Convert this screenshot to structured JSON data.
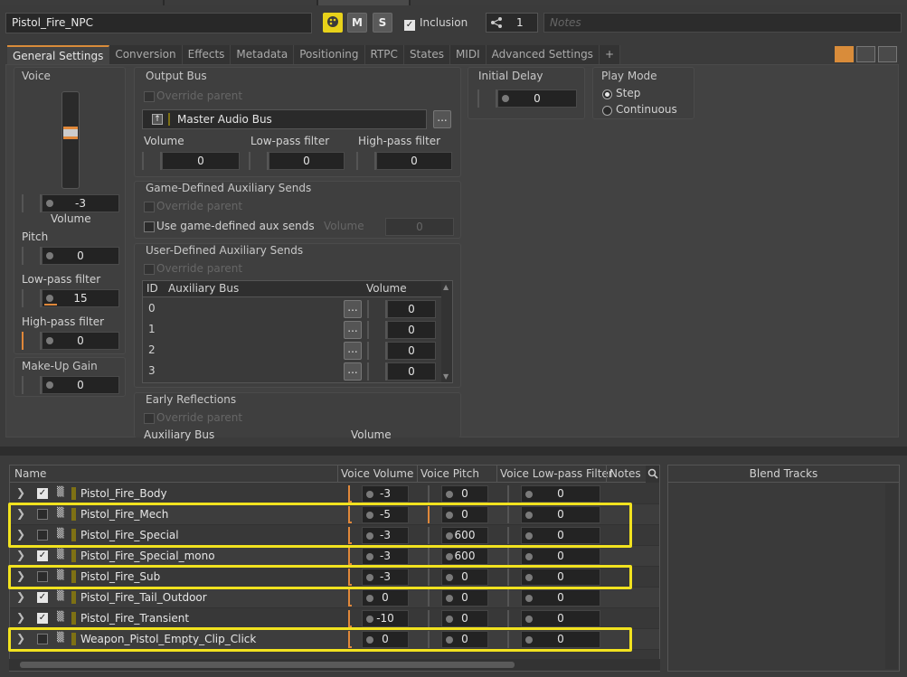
{
  "object_name": "Pistol_Fire_NPC",
  "toolbar": {
    "color_label": "",
    "mute_label": "M",
    "solo_label": "S",
    "inclusion_label": "Inclusion",
    "inclusion_checked": true,
    "share_count": "1",
    "notes_placeholder": "Notes"
  },
  "tabs": [
    "General Settings",
    "Conversion",
    "Effects",
    "Metadata",
    "Positioning",
    "RTPC",
    "States",
    "MIDI",
    "Advanced Settings",
    "+"
  ],
  "active_tab": "General Settings",
  "voice": {
    "title": "Voice",
    "volume_value": "-3",
    "volume_label": "Volume",
    "pitch_label": "Pitch",
    "pitch_value": "0",
    "lowpass_label": "Low-pass filter",
    "lowpass_value": "15",
    "highpass_label": "High-pass filter",
    "highpass_value": "0",
    "makeup_label": "Make-Up Gain",
    "makeup_value": "0"
  },
  "output_bus": {
    "title": "Output Bus",
    "override_label": "Override parent",
    "bus_name": "Master Audio Bus",
    "ellipsis": "...",
    "volume_label": "Volume",
    "volume_value": "0",
    "lowpass_label": "Low-pass filter",
    "lowpass_value": "0",
    "highpass_label": "High-pass filter",
    "highpass_value": "0"
  },
  "game_aux": {
    "title": "Game-Defined Auxiliary Sends",
    "override_label": "Override parent",
    "use_label": "Use game-defined aux sends",
    "volume_label": "Volume",
    "volume_value": "0"
  },
  "user_aux": {
    "title": "User-Defined Auxiliary Sends",
    "override_label": "Override parent",
    "col_id": "ID",
    "col_bus": "Auxiliary Bus",
    "col_volume": "Volume",
    "rows": [
      {
        "id": "0",
        "volume": "0"
      },
      {
        "id": "1",
        "volume": "0"
      },
      {
        "id": "2",
        "volume": "0"
      },
      {
        "id": "3",
        "volume": "0"
      }
    ]
  },
  "early_reflections": {
    "title": "Early Reflections",
    "override_label": "Override parent",
    "aux_bus_label": "Auxiliary Bus",
    "volume_label": "Volume"
  },
  "initial_delay": {
    "title": "Initial Delay",
    "value": "0"
  },
  "play_mode": {
    "title": "Play Mode",
    "step_label": "Step",
    "continuous_label": "Continuous",
    "selected": "Step"
  },
  "grid": {
    "columns": [
      "Name",
      "Voice Volume",
      "Voice Pitch",
      "Voice Low-pass Filter",
      "Notes"
    ],
    "rows": [
      {
        "name": "Pistol_Fire_Body",
        "checked": true,
        "volume": "-3",
        "pitch": "0",
        "lpf": "0",
        "highlight": false
      },
      {
        "name": "Pistol_Fire_Mech",
        "checked": false,
        "volume": "-5",
        "pitch": "0",
        "lpf": "0",
        "highlight": true
      },
      {
        "name": "Pistol_Fire_Special",
        "checked": false,
        "volume": "-3",
        "pitch": "600",
        "lpf": "0",
        "highlight": true
      },
      {
        "name": "Pistol_Fire_Special_mono",
        "checked": true,
        "volume": "-3",
        "pitch": "600",
        "lpf": "0",
        "highlight": false
      },
      {
        "name": "Pistol_Fire_Sub",
        "checked": false,
        "volume": "-3",
        "pitch": "0",
        "lpf": "0",
        "highlight": true
      },
      {
        "name": "Pistol_Fire_Tail_Outdoor",
        "checked": true,
        "volume": "0",
        "pitch": "0",
        "lpf": "0",
        "highlight": false
      },
      {
        "name": "Pistol_Fire_Transient",
        "checked": true,
        "volume": "-10",
        "pitch": "0",
        "lpf": "0",
        "highlight": false
      },
      {
        "name": "Weapon_Pistol_Empty_Clip_Click",
        "checked": false,
        "volume": "0",
        "pitch": "0",
        "lpf": "0",
        "highlight": true
      }
    ]
  },
  "blend_tracks_label": "Blend Tracks",
  "colors": {
    "accent": "#d98c3a",
    "highlight": "#f1e21f",
    "color_swatch": "#e8d21a"
  }
}
